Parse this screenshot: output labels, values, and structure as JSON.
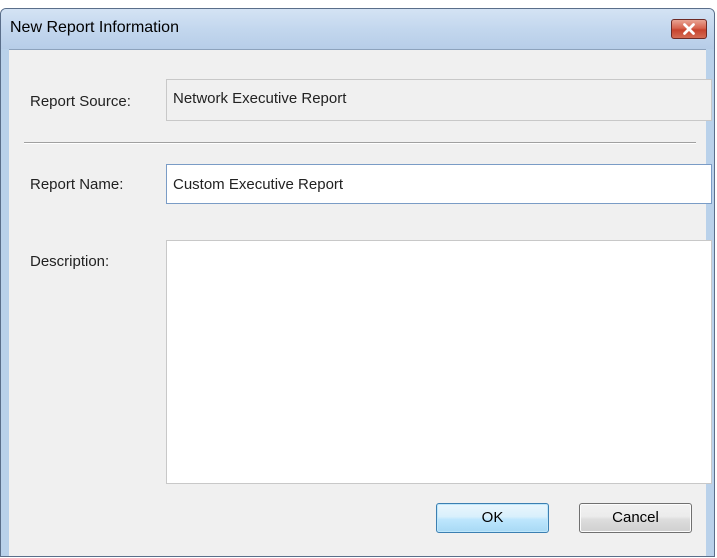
{
  "window": {
    "title": "New Report Information",
    "close_icon": "close-icon"
  },
  "form": {
    "report_source_label": "Report Source:",
    "report_source_value": "Network Executive Report",
    "report_name_label": "Report Name:",
    "report_name_value": "Custom Executive Report",
    "description_label": "Description:",
    "description_value": ""
  },
  "buttons": {
    "ok_label": "OK",
    "cancel_label": "Cancel"
  },
  "colors": {
    "frame": "#b9d1ea",
    "client_background": "#f0f0f0",
    "close_button": "#c7432d",
    "ok_button_border": "#3c7fb1"
  }
}
